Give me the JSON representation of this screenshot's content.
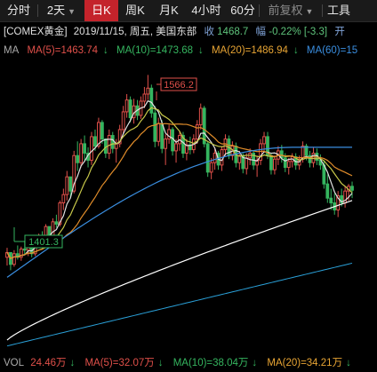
{
  "tabs": [
    {
      "label": "分时",
      "active": false
    },
    {
      "label": "2天",
      "active": false,
      "dropdown": true
    },
    {
      "label": "日K",
      "active": true
    },
    {
      "label": "周K",
      "active": false
    },
    {
      "label": "月K",
      "active": false
    },
    {
      "label": "4小时",
      "active": false
    },
    {
      "label": "60分",
      "active": false
    },
    {
      "label": "前复权",
      "active": false,
      "dropdown": true
    },
    {
      "label": "工具",
      "active": false
    }
  ],
  "info": {
    "symbol": "[COMEX黄金]",
    "date": "2019/11/15, 周五, 美国东部",
    "close_label": "收",
    "close_value": "1468.7",
    "change_label": "幅",
    "change_value": "-0.22%",
    "change_abs": "[-3.3]",
    "open_label": "开"
  },
  "ma": {
    "label": "MA",
    "ma5": "MA(5)=1463.74",
    "ma10": "MA(10)=1473.68",
    "ma20": "MA(20)=1486.94",
    "ma60": "MA(60)=15"
  },
  "annotations": {
    "high": "1566.2",
    "low": "1401.3"
  },
  "vol": {
    "label": "VOL",
    "vol": "24.46万",
    "ma5": "MA(5)=32.07万",
    "ma10": "MA(10)=38.04万",
    "ma20": "MA(20)=34.21万"
  },
  "colors": {
    "up": "#e0504a",
    "down": "#35b55f",
    "ma5": "#e2e2e2",
    "ma10": "#c8c84a",
    "ma20": "#e08c2a",
    "ma60": "#3a8ee0",
    "ma120": "#ffffff",
    "ma250": "#2aa0d8",
    "active_tab": "#c4232b"
  },
  "icons": {
    "down_arrow": "arrow-down-icon",
    "dropdown": "chevron-down-icon"
  },
  "chart_data": {
    "type": "candlestick",
    "high_marker": 1566.2,
    "low_marker": 1401.3,
    "last_close": 1468.7,
    "candles": [
      [
        1412,
        1420,
        1405,
        1416
      ],
      [
        1416,
        1414,
        1401,
        1406
      ],
      [
        1406,
        1418,
        1404,
        1415
      ],
      [
        1415,
        1422,
        1410,
        1412
      ],
      [
        1412,
        1421,
        1409,
        1419
      ],
      [
        1419,
        1426,
        1414,
        1418
      ],
      [
        1418,
        1425,
        1413,
        1423
      ],
      [
        1423,
        1424,
        1412,
        1415
      ],
      [
        1415,
        1428,
        1413,
        1426
      ],
      [
        1426,
        1432,
        1421,
        1430
      ],
      [
        1430,
        1434,
        1424,
        1427
      ],
      [
        1427,
        1440,
        1425,
        1438
      ],
      [
        1438,
        1436,
        1427,
        1430
      ],
      [
        1430,
        1445,
        1428,
        1442
      ],
      [
        1442,
        1448,
        1437,
        1440
      ],
      [
        1440,
        1460,
        1438,
        1458
      ],
      [
        1458,
        1470,
        1452,
        1465
      ],
      [
        1465,
        1485,
        1460,
        1480
      ],
      [
        1480,
        1476,
        1462,
        1468
      ],
      [
        1468,
        1502,
        1466,
        1498
      ],
      [
        1498,
        1510,
        1485,
        1492
      ],
      [
        1492,
        1512,
        1488,
        1508
      ],
      [
        1508,
        1515,
        1494,
        1500
      ],
      [
        1500,
        1505,
        1488,
        1494
      ],
      [
        1494,
        1518,
        1490,
        1514
      ],
      [
        1514,
        1520,
        1502,
        1506
      ],
      [
        1506,
        1530,
        1504,
        1526
      ],
      [
        1526,
        1528,
        1508,
        1512
      ],
      [
        1512,
        1508,
        1496,
        1500
      ],
      [
        1500,
        1520,
        1495,
        1515
      ],
      [
        1515,
        1518,
        1500,
        1504
      ],
      [
        1504,
        1512,
        1492,
        1508
      ],
      [
        1508,
        1524,
        1505,
        1520
      ],
      [
        1520,
        1540,
        1516,
        1535
      ],
      [
        1535,
        1550,
        1530,
        1545
      ],
      [
        1545,
        1548,
        1526,
        1530
      ],
      [
        1530,
        1546,
        1525,
        1540
      ],
      [
        1540,
        1545,
        1528,
        1532
      ],
      [
        1532,
        1548,
        1529,
        1544
      ],
      [
        1544,
        1556,
        1538,
        1550
      ],
      [
        1550,
        1566.2,
        1545,
        1555
      ],
      [
        1555,
        1558,
        1530,
        1534
      ],
      [
        1534,
        1540,
        1505,
        1510
      ],
      [
        1510,
        1530,
        1506,
        1525
      ],
      [
        1525,
        1528,
        1500,
        1504
      ],
      [
        1504,
        1516,
        1490,
        1512
      ],
      [
        1512,
        1524,
        1508,
        1520
      ],
      [
        1520,
        1522,
        1498,
        1502
      ],
      [
        1502,
        1512,
        1492,
        1508
      ],
      [
        1508,
        1519,
        1502,
        1515
      ],
      [
        1515,
        1518,
        1496,
        1500
      ],
      [
        1500,
        1512,
        1494,
        1507
      ],
      [
        1507,
        1514,
        1499,
        1503
      ],
      [
        1503,
        1516,
        1500,
        1512
      ],
      [
        1512,
        1528,
        1508,
        1524
      ],
      [
        1524,
        1542,
        1520,
        1538
      ],
      [
        1538,
        1540,
        1505,
        1508
      ],
      [
        1508,
        1510,
        1480,
        1484
      ],
      [
        1484,
        1496,
        1478,
        1492
      ],
      [
        1492,
        1504,
        1486,
        1500
      ],
      [
        1500,
        1502,
        1486,
        1490
      ],
      [
        1490,
        1506,
        1485,
        1503
      ],
      [
        1503,
        1516,
        1498,
        1512
      ],
      [
        1512,
        1515,
        1495,
        1498
      ],
      [
        1498,
        1510,
        1494,
        1506
      ],
      [
        1506,
        1509,
        1488,
        1492
      ],
      [
        1492,
        1502,
        1486,
        1498
      ],
      [
        1498,
        1500,
        1483,
        1487
      ],
      [
        1487,
        1500,
        1482,
        1496
      ],
      [
        1496,
        1504,
        1490,
        1500
      ],
      [
        1500,
        1502,
        1486,
        1490
      ],
      [
        1490,
        1498,
        1480,
        1494
      ],
      [
        1494,
        1512,
        1490,
        1508
      ],
      [
        1508,
        1518,
        1502,
        1514
      ],
      [
        1514,
        1518,
        1495,
        1498
      ],
      [
        1498,
        1500,
        1482,
        1486
      ],
      [
        1486,
        1498,
        1482,
        1495
      ],
      [
        1495,
        1506,
        1490,
        1502
      ],
      [
        1502,
        1507,
        1492,
        1496
      ],
      [
        1496,
        1500,
        1484,
        1488
      ],
      [
        1488,
        1496,
        1482,
        1493
      ],
      [
        1493,
        1500,
        1488,
        1497
      ],
      [
        1497,
        1500,
        1486,
        1490
      ],
      [
        1490,
        1498,
        1486,
        1495
      ],
      [
        1495,
        1510,
        1492,
        1506
      ],
      [
        1506,
        1508,
        1494,
        1498
      ],
      [
        1498,
        1502,
        1488,
        1492
      ],
      [
        1492,
        1505,
        1488,
        1500
      ],
      [
        1500,
        1504,
        1490,
        1494
      ],
      [
        1494,
        1499,
        1486,
        1490
      ],
      [
        1490,
        1494,
        1470,
        1474
      ],
      [
        1474,
        1482,
        1458,
        1462
      ],
      [
        1462,
        1470,
        1452,
        1458
      ],
      [
        1458,
        1466,
        1448,
        1452
      ],
      [
        1452,
        1468,
        1446,
        1464
      ],
      [
        1464,
        1470,
        1455,
        1458
      ],
      [
        1458,
        1472,
        1454,
        1468
      ],
      [
        1468,
        1474,
        1460,
        1472
      ],
      [
        1472,
        1476,
        1462,
        1468.7
      ]
    ],
    "ma_series_start": [
      {
        "name": "MA(5)",
        "last": 1463.74
      },
      {
        "name": "MA(10)",
        "last": 1473.68
      },
      {
        "name": "MA(20)",
        "last": 1486.94
      }
    ],
    "ylim": [
      1330,
      1580
    ]
  }
}
